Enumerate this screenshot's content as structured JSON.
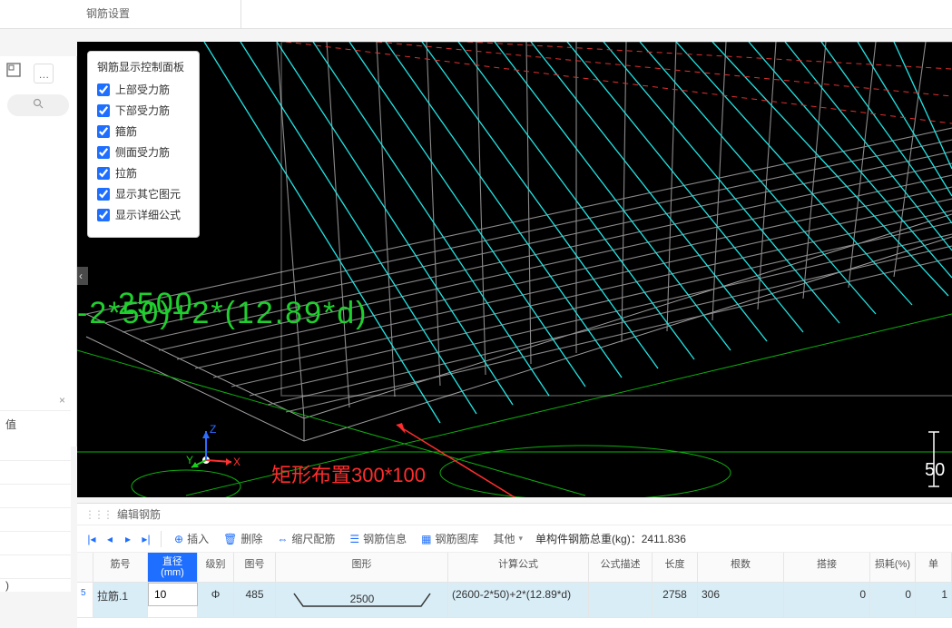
{
  "top": {
    "title": "钢筋设置"
  },
  "control_panel": {
    "title": "钢筋显示控制面板",
    "opts": [
      {
        "label": "上部受力筋",
        "on": true
      },
      {
        "label": "下部受力筋",
        "on": true
      },
      {
        "label": "箍筋",
        "on": true
      },
      {
        "label": "侧面受力筋",
        "on": true
      },
      {
        "label": "拉筋",
        "on": true
      },
      {
        "label": "显示其它图元",
        "on": true
      },
      {
        "label": "显示详细公式",
        "on": true
      }
    ]
  },
  "viewport": {
    "green_formula_a": "2500",
    "green_formula_b": "-2*50)+2*(12.89*d)",
    "red_note": "矩形布置300*100",
    "right_dim": "50"
  },
  "gizmo": {
    "x": "X",
    "y": "Y",
    "z": "Z"
  },
  "left2": {
    "val_label": "值",
    "paren": ")"
  },
  "bottom": {
    "header": "编辑钢筋",
    "tool": {
      "insert": "插入",
      "delete": "删除",
      "ruler": "缩尺配筋",
      "info": "钢筋信息",
      "lib": "钢筋图库",
      "other": "其他",
      "total_label": "单构件钢筋总重(kg)：",
      "total_value": "2411.836"
    },
    "cols": {
      "num": "",
      "name": "筋号",
      "dia": "直径\n(mm)",
      "grade": "级别",
      "fig": "图号",
      "shape": "图形",
      "formula": "计算公式",
      "desc": "公式描述",
      "len": "长度",
      "qty": "根数",
      "lap": "搭接",
      "loss": "损耗(%)",
      "single": "单"
    },
    "row": {
      "num": "5",
      "name": "拉筋.1",
      "dia": "10",
      "grade": "Φ",
      "fig": "485",
      "shape_dim": "2500",
      "formula": "(2600-2*50)+2*(12.89*d)",
      "desc": "",
      "len": "2758",
      "qty": "306",
      "lap": "0",
      "loss": "0",
      "single": "1"
    }
  }
}
